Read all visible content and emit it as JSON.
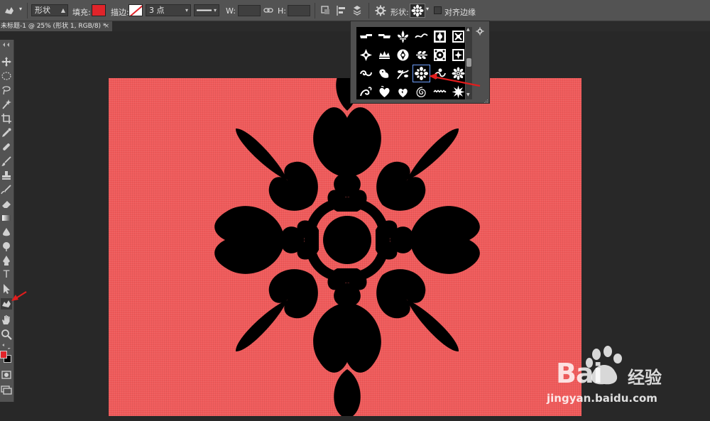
{
  "options_bar": {
    "mode_value": "形状",
    "fill_label": "填充:",
    "fill_color": "#e0242a",
    "stroke_label": "描边:",
    "stroke_width_value": "3 点",
    "width_label": "W:",
    "height_label": "H:",
    "shape_label": "形状:",
    "align_edges_label": "对齐边缘"
  },
  "document_tab": {
    "title": "未标题-1 @ 25% (形状 1, RGB/8) *",
    "close": "×"
  },
  "colors": {
    "canvas_bg": "#f05a5a",
    "foreground": "#e0242a",
    "background": "#000000",
    "annotation_arrow": "#e21d1d"
  },
  "toolbox": {
    "type_tool_glyph": "T",
    "active_tool": "custom-shape-tool"
  },
  "shape_picker": {
    "selected_shape": "flower-ornament",
    "shapes": [
      "pointing-hand-right",
      "pointing-hand-left",
      "fleur-de-lis",
      "swash",
      "square-frame-ornate",
      "square-frame-knot",
      "diamond-ornament",
      "crown-ornament",
      "tile-ornament",
      "leaf-spray",
      "square-tile-flower",
      "square-tile-cross",
      "curl-ornament",
      "bird-ornament",
      "vine-ornament",
      "flower-ornament",
      "floral-scroll",
      "daisy",
      "swirl-ornament",
      "heart-ornament",
      "heart-swirl",
      "spiral",
      "zigzag",
      "starburst"
    ]
  },
  "watermark": {
    "brand": "Bai",
    "brand_cn": "经验",
    "url": "jingyan.baidu.com"
  }
}
